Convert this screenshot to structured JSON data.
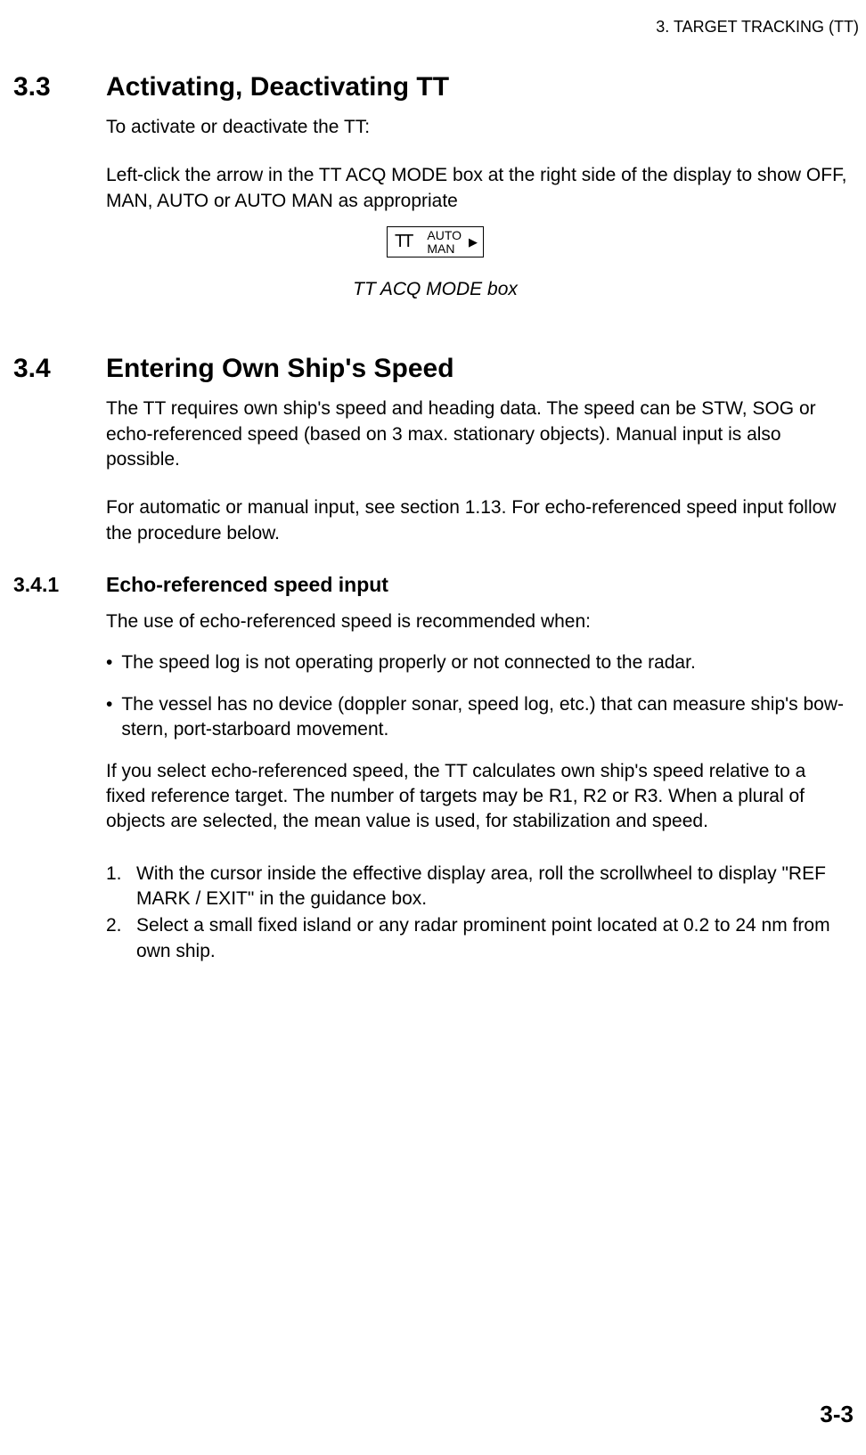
{
  "header": "3. TARGET TRACKING (TT)",
  "section1": {
    "num": "3.3",
    "title": "Activating, Deactivating TT",
    "intro": "To activate or deactivate the TT:",
    "para": "Left-click the arrow in the TT ACQ MODE box at the right side of the display to show OFF, MAN, AUTO or AUTO MAN as appropriate",
    "box_line1": "AUTO",
    "box_line2": "MAN",
    "caption": "TT ACQ MODE box"
  },
  "section2": {
    "num": "3.4",
    "title": "Entering Own Ship's Speed",
    "para1": "The TT requires own ship's speed and heading data. The speed can be STW, SOG or echo-referenced speed (based on 3 max. stationary objects). Manual input is also possible.",
    "para2": "For automatic or manual input, see section 1.13. For echo-referenced speed input follow the procedure below."
  },
  "subsection": {
    "num": "3.4.1",
    "title": "Echo-referenced speed input",
    "intro": "The use of echo-referenced speed is recommended when:",
    "bullets": [
      "The speed log is not operating properly or not connected to the radar.",
      "The vessel has no device (doppler sonar, speed log, etc.) that can measure ship's bow-stern, port-starboard movement."
    ],
    "after": "If you select echo-referenced speed, the TT calculates own ship's speed relative to a fixed reference target. The number of targets may be R1, R2 or R3. When a plural of objects are selected, the mean value is used, for stabilization and speed.",
    "steps": [
      "With the cursor inside the effective display area, roll the scrollwheel to display \"REF MARK / EXIT\" in the guidance box.",
      "Select a small fixed island or any radar prominent point located at 0.2 to 24 nm from own ship."
    ]
  },
  "footer": "3-3"
}
